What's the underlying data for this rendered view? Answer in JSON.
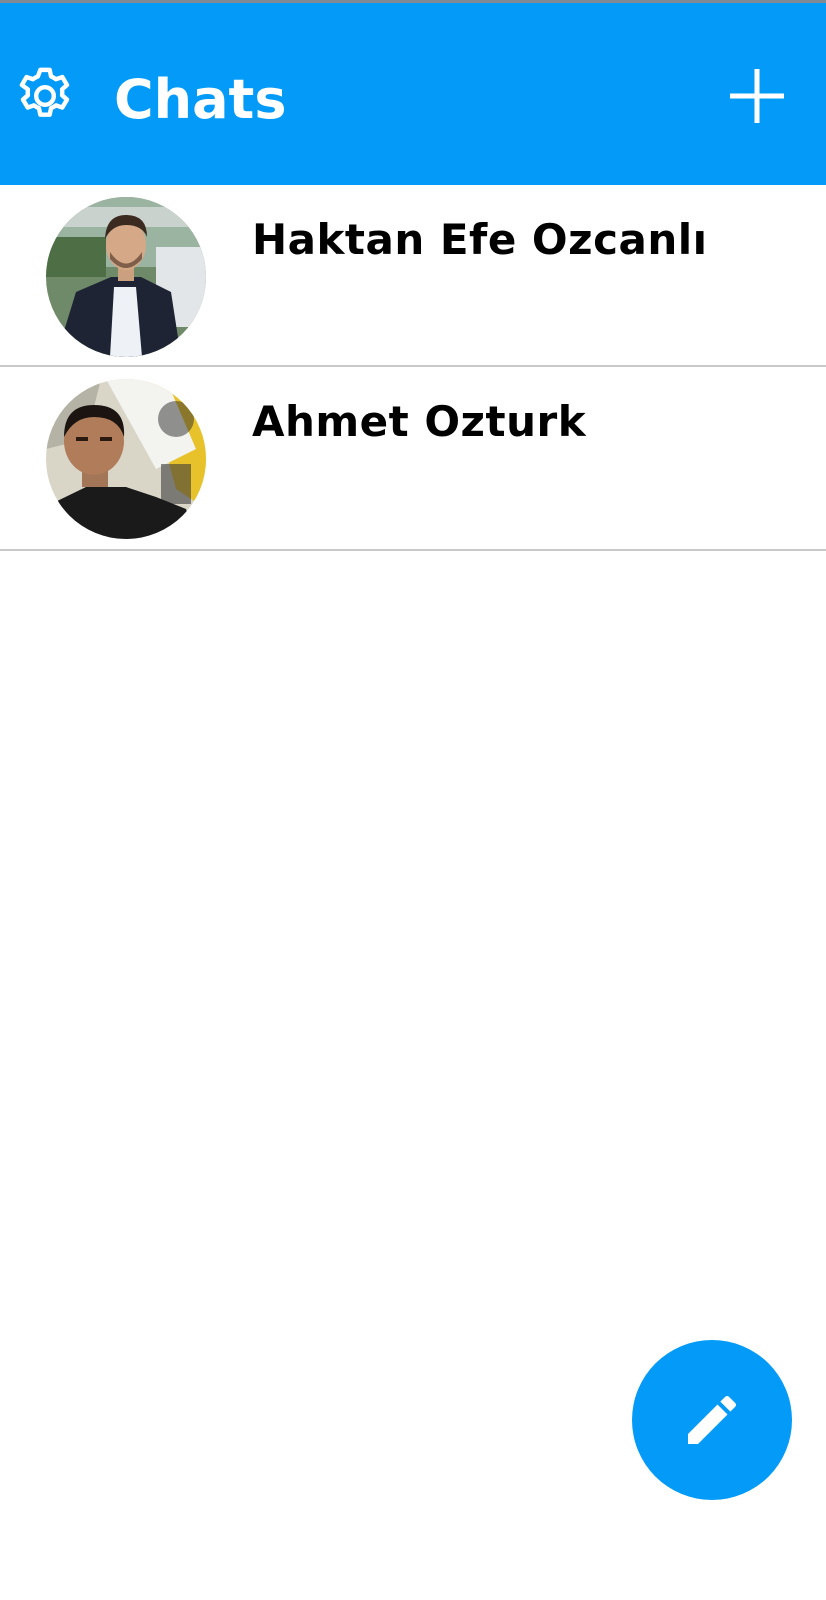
{
  "header": {
    "title": "Chats",
    "bg_color": "#039BF7",
    "settings_icon": "gear-icon",
    "add_icon": "plus-icon"
  },
  "chats": [
    {
      "name": "Haktan Efe Ozcanlı",
      "avatar": "avatar-photo-1"
    },
    {
      "name": "Ahmet Ozturk",
      "avatar": "avatar-photo-2"
    }
  ],
  "fab": {
    "icon": "pencil-icon",
    "color": "#039BF7"
  }
}
